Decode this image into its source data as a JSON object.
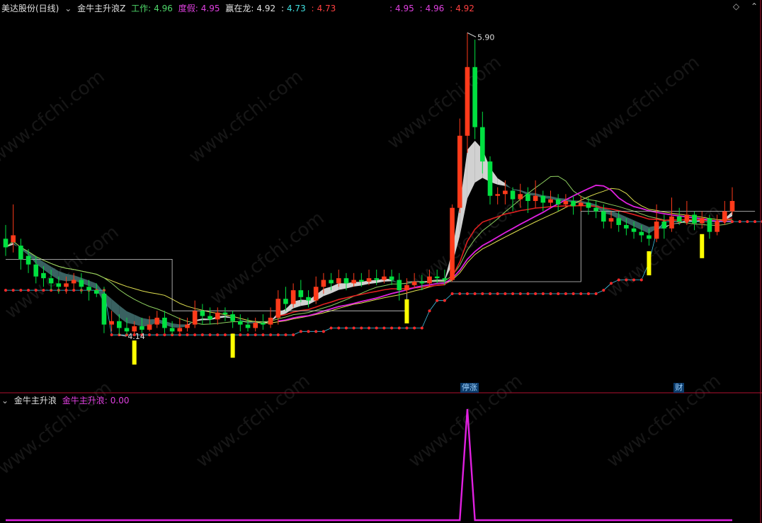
{
  "header": {
    "title": "美达股份(日线)",
    "indicator": "金牛主升浪Z",
    "label_work": "工作:",
    "value_work": "4.96",
    "label_dujia": "度假:",
    "value_dujia": "4.95",
    "label_yingzai": "赢在龙:",
    "value_yingzai_1": "4.92",
    "value_yingzai_2": "4.73",
    "value_yingzai_3": "4.73",
    "value_extra_1": "4.95",
    "value_extra_2": "4.96",
    "value_extra_3": "4.92"
  },
  "sub_header": {
    "indicator": "金牛主升浪",
    "label": "金牛主升浪:",
    "value": "0.00"
  },
  "markers": {
    "limit_up": "停涨",
    "cai": "财"
  },
  "watermark": "www.cfchi.com",
  "colors": {
    "up": "#ff3a1a",
    "down": "#00e040",
    "yellow_bar": "#ffff00",
    "magenta": "#e020e0",
    "red_ma": "#e02020",
    "green_ma": "#8fd060",
    "yellow_ma": "#e0e050",
    "band": "#3f6b6b",
    "band_light": "#e8e8e8",
    "stop_line": "#d0d0d0",
    "dots": "#ff2a2a",
    "divider": "#b01030"
  },
  "chart_data": [
    {
      "type": "candlestick",
      "price_high_label": "5.90",
      "price_low_label": "4.14",
      "ylim": [
        4.05,
        6.0
      ],
      "candles": [
        [
          4.7,
          4.65,
          4.78,
          4.6
        ],
        [
          4.68,
          4.72,
          4.9,
          4.62
        ],
        [
          4.66,
          4.58,
          4.7,
          4.52
        ],
        [
          4.6,
          4.55,
          4.64,
          4.5
        ],
        [
          4.55,
          4.48,
          4.6,
          4.44
        ],
        [
          4.5,
          4.47,
          4.54,
          4.42
        ],
        [
          4.47,
          4.44,
          4.52,
          4.4
        ],
        [
          4.44,
          4.42,
          4.48,
          4.38
        ],
        [
          4.42,
          4.44,
          4.48,
          4.38
        ],
        [
          4.44,
          4.46,
          4.5,
          4.4
        ],
        [
          4.46,
          4.42,
          4.5,
          4.38
        ],
        [
          4.42,
          4.4,
          4.46,
          4.34
        ],
        [
          4.4,
          4.38,
          4.44,
          4.36
        ],
        [
          4.38,
          4.2,
          4.42,
          4.15
        ],
        [
          4.2,
          4.22,
          4.28,
          4.16
        ],
        [
          4.22,
          4.18,
          4.26,
          4.14
        ],
        [
          4.18,
          4.16,
          4.24,
          4.14
        ],
        [
          4.16,
          4.19,
          4.22,
          4.14
        ],
        [
          4.19,
          4.17,
          4.24,
          4.15
        ],
        [
          4.17,
          4.2,
          4.25,
          4.16
        ],
        [
          4.2,
          4.24,
          4.28,
          4.18
        ],
        [
          4.24,
          4.18,
          4.28,
          4.15
        ],
        [
          4.18,
          4.16,
          4.22,
          4.14
        ],
        [
          4.16,
          4.18,
          4.24,
          4.15
        ],
        [
          4.18,
          4.2,
          4.24,
          4.16
        ],
        [
          4.2,
          4.28,
          4.34,
          4.18
        ],
        [
          4.28,
          4.25,
          4.32,
          4.2
        ],
        [
          4.25,
          4.23,
          4.3,
          4.2
        ],
        [
          4.23,
          4.27,
          4.3,
          4.2
        ],
        [
          4.27,
          4.26,
          4.3,
          4.22
        ],
        [
          4.26,
          4.22,
          4.28,
          4.18
        ],
        [
          4.22,
          4.2,
          4.26,
          4.16
        ],
        [
          4.2,
          4.18,
          4.24,
          4.16
        ],
        [
          4.18,
          4.21,
          4.24,
          4.16
        ],
        [
          4.21,
          4.2,
          4.26,
          4.17
        ],
        [
          4.2,
          4.24,
          4.3,
          4.18
        ],
        [
          4.24,
          4.35,
          4.4,
          4.2
        ],
        [
          4.35,
          4.32,
          4.42,
          4.28
        ],
        [
          4.32,
          4.4,
          4.44,
          4.3
        ],
        [
          4.4,
          4.36,
          4.46,
          4.33
        ],
        [
          4.36,
          4.34,
          4.4,
          4.3
        ],
        [
          4.34,
          4.42,
          4.48,
          4.32
        ],
        [
          4.42,
          4.46,
          4.5,
          4.38
        ],
        [
          4.46,
          4.44,
          4.5,
          4.4
        ],
        [
          4.44,
          4.47,
          4.52,
          4.42
        ],
        [
          4.47,
          4.44,
          4.5,
          4.4
        ],
        [
          4.44,
          4.46,
          4.5,
          4.42
        ],
        [
          4.46,
          4.45,
          4.5,
          4.42
        ],
        [
          4.45,
          4.47,
          4.52,
          4.43
        ],
        [
          4.47,
          4.46,
          4.52,
          4.43
        ],
        [
          4.46,
          4.48,
          4.52,
          4.44
        ],
        [
          4.48,
          4.46,
          4.52,
          4.43
        ],
        [
          4.46,
          4.4,
          4.5,
          4.34
        ],
        [
          4.4,
          4.43,
          4.47,
          4.38
        ],
        [
          4.43,
          4.45,
          4.5,
          4.41
        ],
        [
          4.45,
          4.44,
          4.49,
          4.4
        ],
        [
          4.44,
          4.48,
          4.52,
          4.42
        ],
        [
          4.48,
          4.47,
          4.52,
          4.44
        ],
        [
          4.47,
          4.46,
          4.52,
          4.43
        ],
        [
          4.46,
          4.88,
          4.9,
          4.45
        ],
        [
          4.88,
          5.3,
          5.4,
          4.85
        ],
        [
          5.3,
          5.7,
          5.9,
          5.2
        ],
        [
          5.7,
          5.35,
          5.86,
          5.28
        ],
        [
          5.35,
          5.15,
          5.44,
          5.08
        ],
        [
          5.15,
          4.95,
          5.18,
          4.9
        ],
        [
          4.95,
          4.96,
          5.0,
          4.9
        ],
        [
          4.96,
          4.98,
          5.04,
          4.9
        ],
        [
          4.98,
          4.93,
          5.0,
          4.86
        ],
        [
          4.93,
          4.96,
          5.02,
          4.88
        ],
        [
          4.96,
          4.92,
          5.0,
          4.85
        ],
        [
          4.92,
          4.95,
          5.04,
          4.88
        ],
        [
          4.95,
          4.91,
          4.98,
          4.86
        ],
        [
          4.91,
          4.93,
          4.98,
          4.88
        ],
        [
          4.93,
          4.9,
          4.96,
          4.86
        ],
        [
          4.9,
          4.92,
          4.96,
          4.88
        ],
        [
          4.92,
          4.89,
          4.95,
          4.84
        ],
        [
          4.89,
          4.91,
          4.95,
          4.86
        ],
        [
          4.91,
          4.88,
          4.94,
          4.84
        ],
        [
          4.88,
          4.86,
          4.92,
          4.82
        ],
        [
          4.86,
          4.8,
          4.9,
          4.76
        ],
        [
          4.8,
          4.82,
          4.86,
          4.76
        ],
        [
          4.82,
          4.78,
          4.86,
          4.74
        ],
        [
          4.78,
          4.76,
          4.82,
          4.72
        ],
        [
          4.76,
          4.74,
          4.8,
          4.7
        ],
        [
          4.74,
          4.72,
          4.78,
          4.68
        ],
        [
          4.72,
          4.7,
          4.76,
          4.66
        ],
        [
          4.7,
          4.8,
          4.9,
          4.68
        ],
        [
          4.8,
          4.76,
          4.84,
          4.7
        ],
        [
          4.76,
          4.83,
          4.94,
          4.74
        ],
        [
          4.83,
          4.8,
          4.88,
          4.78
        ],
        [
          4.8,
          4.84,
          4.92,
          4.78
        ],
        [
          4.84,
          4.79,
          4.86,
          4.75
        ],
        [
          4.79,
          4.82,
          4.86,
          4.76
        ],
        [
          4.82,
          4.74,
          4.84,
          4.7
        ],
        [
          4.74,
          4.8,
          4.84,
          4.72
        ],
        [
          4.8,
          4.86,
          4.92,
          4.78
        ],
        [
          4.86,
          4.92,
          5.0,
          4.84
        ]
      ],
      "stop_steps": [
        4.58,
        4.58,
        4.58,
        4.58,
        4.58,
        4.58,
        4.58,
        4.58,
        4.58,
        4.58,
        4.58,
        4.58,
        4.58,
        4.58,
        4.58,
        4.58,
        4.58,
        4.58,
        4.58,
        4.58,
        4.58,
        4.58,
        4.28,
        4.28,
        4.28,
        4.28,
        4.28,
        4.28,
        4.28,
        4.28,
        4.28,
        4.28,
        4.28,
        4.28,
        4.28,
        4.28,
        4.28,
        4.28,
        4.28,
        4.28,
        4.28,
        4.28,
        4.28,
        4.28,
        4.28,
        4.28,
        4.28,
        4.28,
        4.28,
        4.28,
        4.28,
        4.28,
        4.28,
        4.45,
        4.45,
        4.45,
        4.45,
        4.45,
        4.45,
        4.45,
        4.45,
        4.45,
        4.45,
        4.45,
        4.45,
        4.45,
        4.45,
        4.45,
        4.45,
        4.45,
        4.45,
        4.45,
        4.45,
        4.45,
        4.45,
        4.45,
        4.86,
        4.86,
        4.86,
        4.86,
        4.86,
        4.86,
        4.86,
        4.86,
        4.86,
        4.86,
        4.86,
        4.86,
        4.86,
        4.86,
        4.86,
        4.86,
        4.86,
        4.86,
        4.86,
        4.86,
        4.86,
        4.86,
        4.86,
        4.86
      ],
      "dot_line": [
        4.4,
        4.4,
        4.4,
        4.4,
        4.4,
        4.4,
        4.4,
        4.4,
        4.4,
        4.4,
        4.4,
        4.4,
        4.4,
        4.4,
        4.14,
        4.14,
        4.14,
        4.14,
        4.14,
        4.14,
        4.14,
        4.14,
        4.14,
        4.14,
        4.14,
        4.14,
        4.14,
        4.14,
        4.14,
        4.14,
        4.14,
        4.14,
        4.14,
        4.14,
        4.14,
        4.14,
        4.14,
        4.14,
        4.14,
        4.16,
        4.16,
        4.16,
        4.16,
        4.18,
        4.18,
        4.18,
        4.18,
        4.18,
        4.18,
        4.18,
        4.18,
        4.18,
        4.18,
        4.18,
        4.18,
        4.18,
        4.28,
        4.34,
        4.34,
        4.38,
        4.38,
        4.38,
        4.38,
        4.38,
        4.38,
        4.38,
        4.38,
        4.38,
        4.38,
        4.38,
        4.38,
        4.38,
        4.38,
        4.38,
        4.38,
        4.38,
        4.38,
        4.38,
        4.38,
        4.4,
        4.44,
        4.46,
        4.46,
        4.46,
        4.46,
        4.56,
        4.74,
        4.8,
        4.8,
        4.8,
        4.8,
        4.8,
        4.8,
        4.8,
        4.8,
        4.8,
        4.8,
        4.8,
        4.8,
        4.8,
        4.8,
        4.8
      ],
      "yellow_bars": [
        17,
        30,
        53,
        85,
        92
      ],
      "limit_up_index": 61,
      "cai_index": 89
    },
    {
      "type": "line",
      "series": [
        {
          "name": "金牛主升浪",
          "spike_index": 61,
          "spike_value": 1,
          "baseline": 0
        }
      ],
      "ylim": [
        0,
        1
      ]
    }
  ]
}
